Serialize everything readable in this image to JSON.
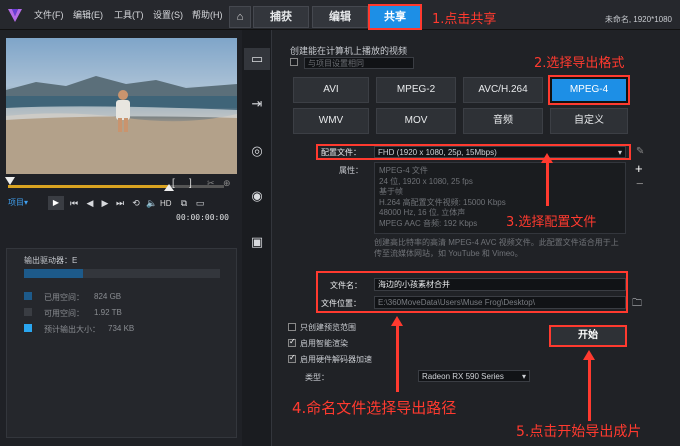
{
  "menubar": {
    "items": [
      "文件(F)",
      "编辑(E)",
      "工具(T)",
      "设置(S)",
      "帮助(H)"
    ],
    "project_info": "未命名, 1920*1080"
  },
  "tabs": [
    {
      "label": "捕获"
    },
    {
      "label": "编辑"
    },
    {
      "label": "共享"
    }
  ],
  "annotations": {
    "step1": "1.点击共享",
    "step2": "2.选择导出格式",
    "step3": "3.选择配置文件",
    "step4": "4.命名文件选择导出路径",
    "step5": "5.点击开始导出成片"
  },
  "player": {
    "mode_label": "项目▾",
    "timecode": "00:00:00:00",
    "hd": "HD",
    "brackets": [
      "[",
      "]"
    ]
  },
  "output": {
    "drive_label": "输出驱动器：E",
    "used_label": "已用空间：",
    "used_value": "824 GB",
    "free_label": "可用空间：",
    "free_value": "1.92 TB",
    "est_label": "预计输出大小：",
    "est_value": "734 KB",
    "usage_fraction": 0.3
  },
  "share": {
    "heading": "创建能在计算机上播放的视频",
    "same_as_project": "与项目设置相同",
    "formats_row1": [
      "AVI",
      "MPEG-2",
      "AVC/H.264",
      "MPEG-4"
    ],
    "formats_row2": [
      "WMV",
      "MOV",
      "音频",
      "自定义"
    ],
    "profile_label": "配置文件：",
    "profile_value": "FHD (1920 x 1080, 25p, 15Mbps)",
    "props_label": "属性：",
    "props": [
      "MPEG-4 文件",
      "24 位, 1920 x 1080, 25 fps",
      "基于帧",
      "H.264 高配置文件视频: 15000 Kbps",
      "48000 Hz, 16 位, 立体声",
      "MPEG AAC 音频: 192 Kbps"
    ],
    "description": "创建高比特率的高清 MPEG-4 AVC 视频文件。此配置文件适合用于上传至流媒体网站，如 YouTube 和 Vimeo。",
    "filename_label": "文件名：",
    "filename_value": "海边的小孩素材合并",
    "location_label": "文件位置：",
    "location_value": "E:\\360MoveData\\Users\\Muse Frog\\Desktop\\",
    "opt_preview": "只创建预览范围",
    "opt_smart": "启用智能渲染",
    "opt_hw": "启用硬件解码器加速",
    "type_label": "类型：",
    "type_value": "Radeon RX 590 Series",
    "start_label": "开始"
  }
}
